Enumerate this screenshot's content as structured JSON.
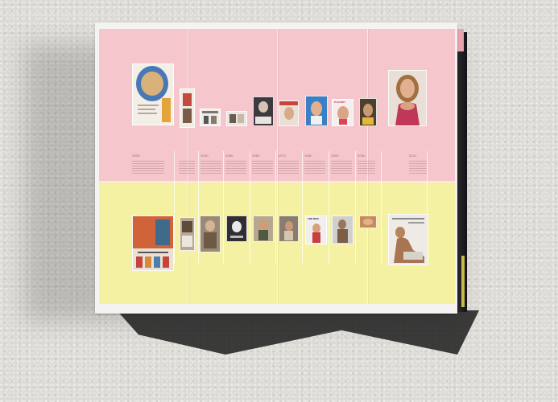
{
  "timeline": {
    "years": [
      "1930",
      "1940",
      "1950",
      "1960",
      "1970",
      "1980",
      "1990",
      "2000",
      "2011"
    ]
  },
  "magazine": {
    "playboy_masthead": "PLAYBOY",
    "men_masthead": "THE MAN"
  },
  "colors": {
    "pink_band": "#f5c6cc",
    "yellow_band": "#f4f1a3",
    "wall": "#dcdad4"
  }
}
